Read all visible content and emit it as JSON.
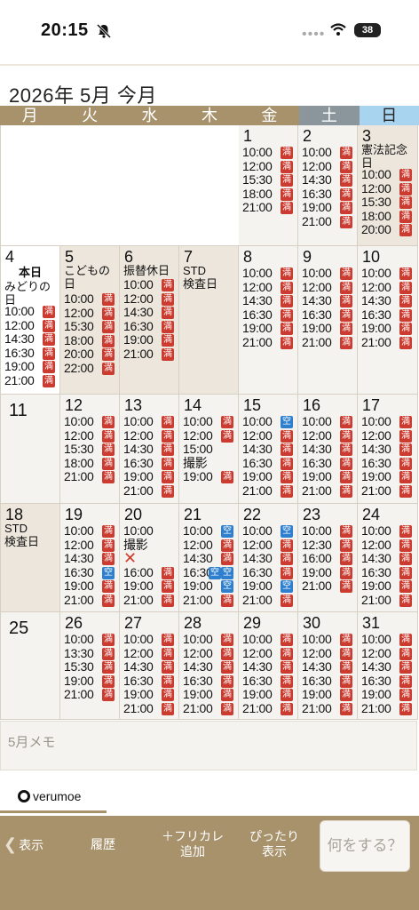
{
  "status": {
    "time": "20:15",
    "battery": "38"
  },
  "header": {
    "title": "2026年 5月 今月"
  },
  "weekdays": [
    "月",
    "火",
    "水",
    "木",
    "金",
    "土",
    "日"
  ],
  "colors": {
    "full": "#cc3b2f",
    "open": "#2f7fcf",
    "header": "#a8926c",
    "saturday": "#8a969c",
    "sunday": "#a9d4ef"
  },
  "calendar": {
    "days": [
      {
        "day": "1",
        "slots": [
          {
            "time": "10:00",
            "badge": "満"
          },
          {
            "time": "12:00",
            "badge": "満"
          },
          {
            "time": "15:30",
            "badge": "満"
          },
          {
            "time": "18:00",
            "badge": "満"
          },
          {
            "time": "21:00",
            "badge": "満"
          }
        ]
      },
      {
        "day": "2",
        "slots": [
          {
            "time": "10:00",
            "badge": "満"
          },
          {
            "time": "12:00",
            "badge": "満"
          },
          {
            "time": "14:30",
            "badge": "満"
          },
          {
            "time": "16:30",
            "badge": "満"
          },
          {
            "time": "19:00",
            "badge": "満"
          },
          {
            "time": "21:00",
            "badge": "満"
          }
        ]
      },
      {
        "day": "3",
        "holiday": "憲法記念日",
        "slots": [
          {
            "time": "10:00",
            "badge": "満"
          },
          {
            "time": "12:00",
            "badge": "満"
          },
          {
            "time": "15:30",
            "badge": "満"
          },
          {
            "time": "18:00",
            "badge": "満"
          },
          {
            "time": "20:00",
            "badge": "満"
          }
        ]
      },
      {
        "day": "4",
        "today_label": "本日",
        "holiday": "みどりの日",
        "slots": [
          {
            "time": "10:00",
            "badge": "満"
          },
          {
            "time": "12:00",
            "badge": "満"
          },
          {
            "time": "14:30",
            "badge": "満"
          },
          {
            "time": "16:30",
            "badge": "満"
          },
          {
            "time": "19:00",
            "badge": "満"
          },
          {
            "time": "21:00",
            "badge": "満"
          }
        ]
      },
      {
        "day": "5",
        "holiday": "こどもの日",
        "slots": [
          {
            "time": "10:00",
            "badge": "満"
          },
          {
            "time": "12:00",
            "badge": "満"
          },
          {
            "time": "15:30",
            "badge": "満"
          },
          {
            "time": "18:00",
            "badge": "満"
          },
          {
            "time": "20:00",
            "badge": "満"
          },
          {
            "time": "22:00",
            "badge": "満"
          }
        ]
      },
      {
        "day": "6",
        "holiday": "振替休日",
        "slots": [
          {
            "time": "10:00",
            "badge": "満"
          },
          {
            "time": "12:00",
            "badge": "満"
          },
          {
            "time": "14:30",
            "badge": "満"
          },
          {
            "time": "16:30",
            "badge": "満"
          },
          {
            "time": "19:00",
            "badge": "満"
          },
          {
            "time": "21:00",
            "badge": "満"
          }
        ]
      },
      {
        "day": "7",
        "holiday": "STD\n検査日",
        "slots": []
      },
      {
        "day": "8",
        "slots": [
          {
            "time": "10:00",
            "badge": "満"
          },
          {
            "time": "12:00",
            "badge": "満"
          },
          {
            "time": "14:30",
            "badge": "満"
          },
          {
            "time": "16:30",
            "badge": "満"
          },
          {
            "time": "19:00",
            "badge": "満"
          },
          {
            "time": "21:00",
            "badge": "満"
          }
        ]
      },
      {
        "day": "9",
        "slots": [
          {
            "time": "10:00",
            "badge": "満"
          },
          {
            "time": "12:00",
            "badge": "満"
          },
          {
            "time": "14:30",
            "badge": "満"
          },
          {
            "time": "16:30",
            "badge": "満"
          },
          {
            "time": "19:00",
            "badge": "満"
          },
          {
            "time": "21:00",
            "badge": "満"
          }
        ]
      },
      {
        "day": "10",
        "slots": [
          {
            "time": "10:00",
            "badge": "満"
          },
          {
            "time": "12:00",
            "badge": "満"
          },
          {
            "time": "14:30",
            "badge": "満"
          },
          {
            "time": "16:30",
            "badge": "満"
          },
          {
            "time": "19:00",
            "badge": "満"
          },
          {
            "time": "21:00",
            "badge": "満"
          }
        ]
      },
      {
        "day": "11",
        "slots": []
      },
      {
        "day": "12",
        "slots": [
          {
            "time": "10:00",
            "badge": "満"
          },
          {
            "time": "12:00",
            "badge": "満"
          },
          {
            "time": "15:30",
            "badge": "満"
          },
          {
            "time": "18:00",
            "badge": "満"
          },
          {
            "time": "21:00",
            "badge": "満"
          }
        ]
      },
      {
        "day": "13",
        "slots": [
          {
            "time": "10:00",
            "badge": "満"
          },
          {
            "time": "12:00",
            "badge": "満"
          },
          {
            "time": "14:30",
            "badge": "満"
          },
          {
            "time": "16:30",
            "badge": "満"
          },
          {
            "time": "19:00",
            "badge": "満"
          },
          {
            "time": "21:00",
            "badge": "満"
          }
        ]
      },
      {
        "day": "14",
        "slots": [
          {
            "time": "10:00",
            "badge": "満"
          },
          {
            "time": "12:00",
            "badge": "満"
          },
          {
            "time": "15:00",
            "badge": ""
          },
          {
            "time": "撮影",
            "badge": ""
          },
          {
            "time": "19:00",
            "badge": "満"
          }
        ]
      },
      {
        "day": "15",
        "slots": [
          {
            "time": "10:00",
            "badge": "空"
          },
          {
            "time": "12:00",
            "badge": "満"
          },
          {
            "time": "14:30",
            "badge": "満"
          },
          {
            "time": "16:30",
            "badge": "満"
          },
          {
            "time": "19:00",
            "badge": "満"
          },
          {
            "time": "21:00",
            "badge": "満"
          }
        ]
      },
      {
        "day": "16",
        "slots": [
          {
            "time": "10:00",
            "badge": "満"
          },
          {
            "time": "12:00",
            "badge": "満"
          },
          {
            "time": "14:30",
            "badge": "満"
          },
          {
            "time": "16:30",
            "badge": "満"
          },
          {
            "time": "19:00",
            "badge": "満"
          },
          {
            "time": "21:00",
            "badge": "満"
          }
        ]
      },
      {
        "day": "17",
        "slots": [
          {
            "time": "10:00",
            "badge": "満"
          },
          {
            "time": "12:00",
            "badge": "満"
          },
          {
            "time": "14:30",
            "badge": "満"
          },
          {
            "time": "16:30",
            "badge": "満"
          },
          {
            "time": "19:00",
            "badge": "満"
          },
          {
            "time": "21:00",
            "badge": "満"
          }
        ]
      },
      {
        "day": "18",
        "holiday": "STD\n検査日",
        "slots": []
      },
      {
        "day": "19",
        "slots": [
          {
            "time": "10:00",
            "badge": "満"
          },
          {
            "time": "12:00",
            "badge": "満"
          },
          {
            "time": "14:30",
            "badge": "満"
          },
          {
            "time": "16:30",
            "badge": "空"
          },
          {
            "time": "19:00",
            "badge": "満"
          },
          {
            "time": "21:00",
            "badge": "満"
          }
        ]
      },
      {
        "day": "20",
        "slots": [
          {
            "time": "10:00",
            "badge": ""
          },
          {
            "time": "撮影",
            "badge": ""
          },
          {
            "time": "✕",
            "badge": ""
          },
          {
            "time": "16:00",
            "badge": "満"
          },
          {
            "time": "19:00",
            "badge": "満"
          },
          {
            "time": "21:00",
            "badge": "満"
          }
        ]
      },
      {
        "day": "21",
        "slots": [
          {
            "time": "10:00",
            "badge": "空"
          },
          {
            "time": "12:00",
            "badge": "満"
          },
          {
            "time": "14:30",
            "badge": "満"
          },
          {
            "time": "16:30",
            "badge": "空",
            "badge2": "空"
          },
          {
            "time": "19:00",
            "badge": "空"
          },
          {
            "time": "21:00",
            "badge": "満"
          }
        ]
      },
      {
        "day": "22",
        "slots": [
          {
            "time": "10:00",
            "badge": "空"
          },
          {
            "time": "12:00",
            "badge": "満"
          },
          {
            "time": "14:30",
            "badge": "満"
          },
          {
            "time": "16:30",
            "badge": "満"
          },
          {
            "time": "19:00",
            "badge": "空"
          },
          {
            "time": "21:00",
            "badge": "満"
          }
        ]
      },
      {
        "day": "23",
        "slots": [
          {
            "time": "10:00",
            "badge": "満"
          },
          {
            "time": "12:30",
            "badge": "満"
          },
          {
            "time": "16:00",
            "badge": "満"
          },
          {
            "time": "19:00",
            "badge": "満"
          },
          {
            "time": "21:00",
            "badge": "満"
          }
        ]
      },
      {
        "day": "24",
        "slots": [
          {
            "time": "10:00",
            "badge": "満"
          },
          {
            "time": "12:00",
            "badge": "満"
          },
          {
            "time": "14:30",
            "badge": "満"
          },
          {
            "time": "16:30",
            "badge": "満"
          },
          {
            "time": "19:00",
            "badge": "満"
          },
          {
            "time": "21:00",
            "badge": "満"
          }
        ]
      },
      {
        "day": "25",
        "slots": []
      },
      {
        "day": "26",
        "slots": [
          {
            "time": "10:00",
            "badge": "満"
          },
          {
            "time": "13:30",
            "badge": "満"
          },
          {
            "time": "15:30",
            "badge": "満"
          },
          {
            "time": "19:00",
            "badge": "満"
          },
          {
            "time": "21:00",
            "badge": "満"
          }
        ]
      },
      {
        "day": "27",
        "slots": [
          {
            "time": "10:00",
            "badge": "満"
          },
          {
            "time": "12:00",
            "badge": "満"
          },
          {
            "time": "14:30",
            "badge": "満"
          },
          {
            "time": "16:30",
            "badge": "満"
          },
          {
            "time": "19:00",
            "badge": "満"
          },
          {
            "time": "21:00",
            "badge": "満"
          }
        ]
      },
      {
        "day": "28",
        "slots": [
          {
            "time": "10:00",
            "badge": "満"
          },
          {
            "time": "12:00",
            "badge": "満"
          },
          {
            "time": "14:30",
            "badge": "満"
          },
          {
            "time": "16:30",
            "badge": "満"
          },
          {
            "time": "19:00",
            "badge": "満"
          },
          {
            "time": "21:00",
            "badge": "満"
          }
        ]
      },
      {
        "day": "29",
        "slots": [
          {
            "time": "10:00",
            "badge": "満"
          },
          {
            "time": "12:00",
            "badge": "満"
          },
          {
            "time": "14:30",
            "badge": "満"
          },
          {
            "time": "16:30",
            "badge": "満"
          },
          {
            "time": "19:00",
            "badge": "満"
          },
          {
            "time": "21:00",
            "badge": "満"
          }
        ]
      },
      {
        "day": "30",
        "slots": [
          {
            "time": "10:00",
            "badge": "満"
          },
          {
            "time": "12:00",
            "badge": "満"
          },
          {
            "time": "14:30",
            "badge": "満"
          },
          {
            "time": "16:30",
            "badge": "満"
          },
          {
            "time": "19:00",
            "badge": "満"
          },
          {
            "time": "21:00",
            "badge": "満"
          }
        ]
      },
      {
        "day": "31",
        "slots": [
          {
            "time": "10:00",
            "badge": "満"
          },
          {
            "time": "12:00",
            "badge": "満"
          },
          {
            "time": "14:30",
            "badge": "満"
          },
          {
            "time": "16:30",
            "badge": "満"
          },
          {
            "time": "19:00",
            "badge": "満"
          },
          {
            "time": "21:00",
            "badge": "満"
          }
        ]
      }
    ]
  },
  "memo": {
    "placeholder": "5月メモ"
  },
  "logo": {
    "text": "verumoe"
  },
  "toolbar": {
    "back_label": "表示",
    "history_label": "履歴",
    "furikare_label": "＋フリカレ\n追加",
    "fit_label": "ぴったり\n表示",
    "what_label": "何をする？"
  }
}
